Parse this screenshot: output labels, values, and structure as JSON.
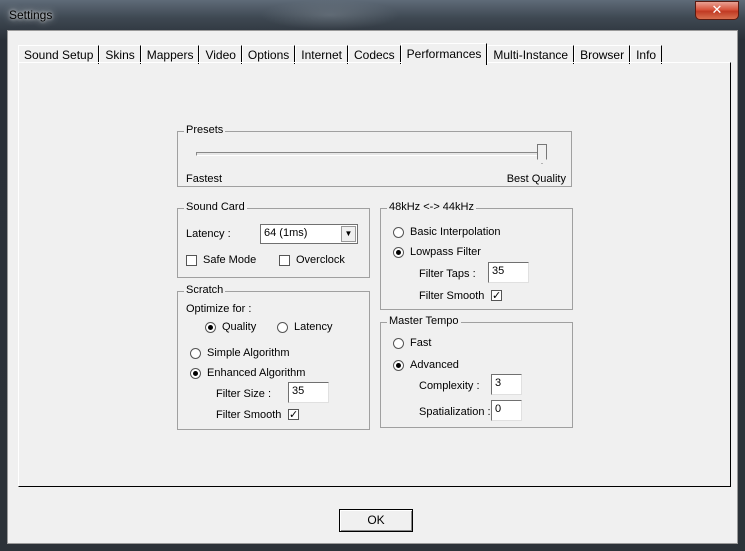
{
  "window": {
    "title": "Settings",
    "close_glyph": "✕"
  },
  "tabs": [
    {
      "label": "Sound Setup"
    },
    {
      "label": "Skins"
    },
    {
      "label": "Mappers"
    },
    {
      "label": "Video"
    },
    {
      "label": "Options"
    },
    {
      "label": "Internet"
    },
    {
      "label": "Codecs"
    },
    {
      "label": "Performances",
      "active": true
    },
    {
      "label": "Multi-Instance"
    },
    {
      "label": "Browser"
    },
    {
      "label": "Info"
    }
  ],
  "presets": {
    "title": "Presets",
    "min_label": "Fastest",
    "max_label": "Best Quality",
    "level": 1.0
  },
  "sound_card": {
    "title": "Sound Card",
    "latency_label": "Latency :",
    "latency_value": "64 (1ms)",
    "safe_mode_label": "Safe Mode",
    "safe_mode_checked": false,
    "overclock_label": "Overclock",
    "overclock_checked": false
  },
  "resample": {
    "title": "48kHz <-> 44kHz",
    "basic_label": "Basic Interpolation",
    "basic_selected": false,
    "lowpass_label": "Lowpass Filter",
    "lowpass_selected": true,
    "filter_taps_label": "Filter Taps :",
    "filter_taps_value": "35",
    "filter_smooth_label": "Filter Smooth",
    "filter_smooth_checked": true
  },
  "scratch": {
    "title": "Scratch",
    "optimize_label": "Optimize for :",
    "quality_label": "Quality",
    "quality_selected": true,
    "latency_label": "Latency",
    "latency_selected": false,
    "simple_label": "Simple Algorithm",
    "simple_selected": false,
    "enhanced_label": "Enhanced Algorithm",
    "enhanced_selected": true,
    "filter_size_label": "Filter Size :",
    "filter_size_value": "35",
    "filter_smooth_label": "Filter Smooth",
    "filter_smooth_checked": true
  },
  "master_tempo": {
    "title": "Master Tempo",
    "fast_label": "Fast",
    "fast_selected": false,
    "advanced_label": "Advanced",
    "advanced_selected": true,
    "complexity_label": "Complexity :",
    "complexity_value": "3",
    "spatialization_label": "Spatialization :",
    "spatialization_value": "0"
  },
  "buttons": {
    "ok_label": "OK"
  },
  "colors": {
    "client_bg": "#f0f0f0",
    "close_button": "#c94a32"
  }
}
